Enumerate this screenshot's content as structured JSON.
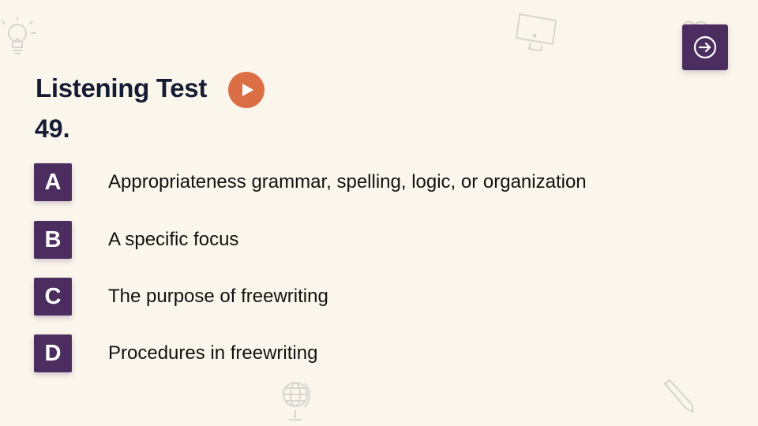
{
  "header": {
    "title": "Listening Test",
    "question_number": "49."
  },
  "options": [
    {
      "letter": "A",
      "text": "Appropriateness grammar, spelling, logic, or organization"
    },
    {
      "letter": "B",
      "text": "A specific focus"
    },
    {
      "letter": "C",
      "text": "The purpose of freewriting"
    },
    {
      "letter": "D",
      "text": "Procedures in freewriting"
    }
  ],
  "icons": {
    "play": "play-icon",
    "next": "arrow-right-circle-icon",
    "decorations": [
      "lightbulb-icon",
      "monitor-icon",
      "heart-icon",
      "globe-icon",
      "pencil-icon"
    ]
  },
  "colors": {
    "background": "#fbf6ec",
    "accent_purple": "#4b2e5f",
    "play_orange": "#dc6e45",
    "title_text": "#141b33",
    "option_text": "#111111"
  }
}
